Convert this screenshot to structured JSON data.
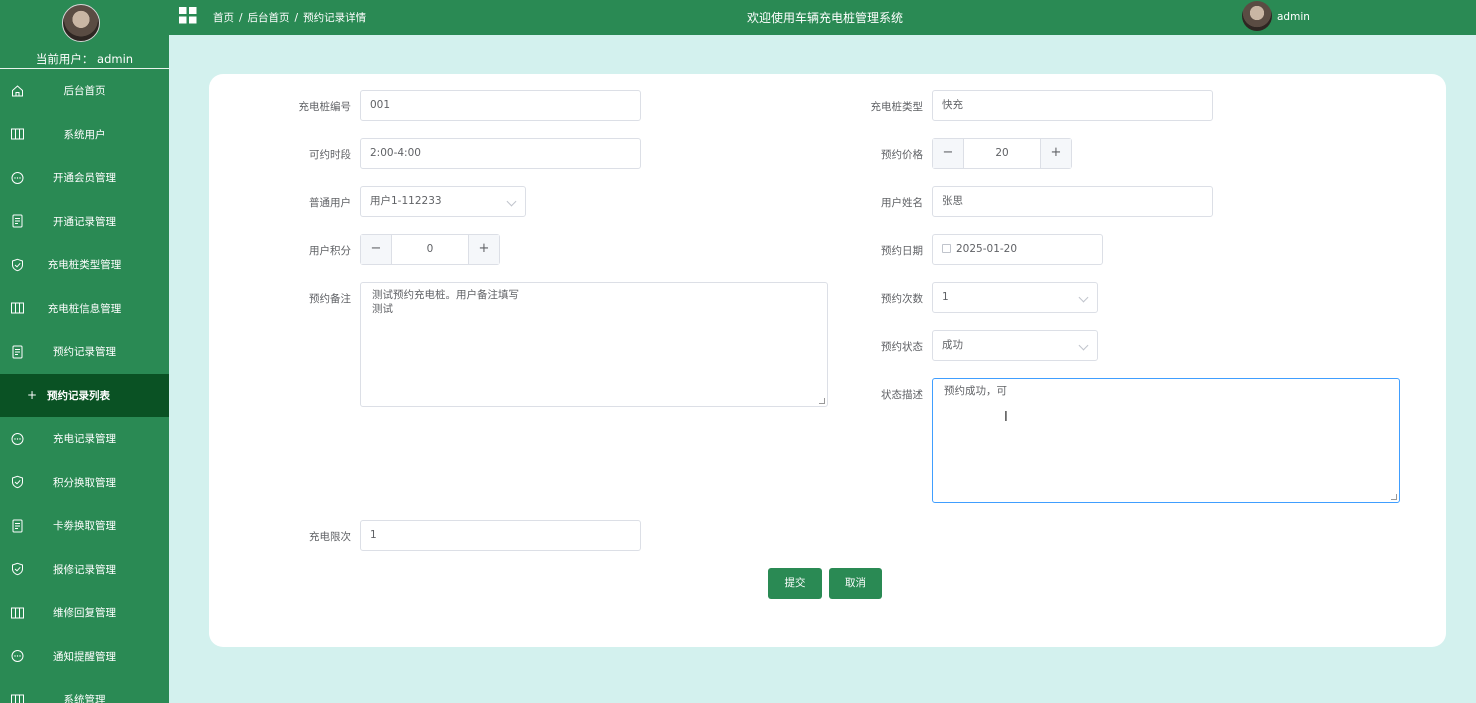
{
  "sidebar": {
    "current_user": "当前用户：  admin",
    "items": [
      {
        "label": "后台首页",
        "icon": "home-icon"
      },
      {
        "label": "系统用户",
        "icon": "columns-icon"
      },
      {
        "label": "开通会员管理",
        "icon": "chat-icon"
      },
      {
        "label": "开通记录管理",
        "icon": "document-icon"
      },
      {
        "label": "充电桩类型管理",
        "icon": "shield-icon"
      },
      {
        "label": "充电桩信息管理",
        "icon": "columns-icon"
      },
      {
        "label": "预约记录管理",
        "icon": "document-icon"
      },
      {
        "label": "预约记录列表",
        "icon": "plus-icon",
        "sub": true
      },
      {
        "label": "充电记录管理",
        "icon": "chat-icon"
      },
      {
        "label": "积分换取管理",
        "icon": "shield-icon"
      },
      {
        "label": "卡劵换取管理",
        "icon": "document-icon"
      },
      {
        "label": "报修记录管理",
        "icon": "shield-icon"
      },
      {
        "label": "维修回复管理",
        "icon": "columns-icon"
      },
      {
        "label": "通知提醒管理",
        "icon": "chat-icon"
      },
      {
        "label": "系统管理",
        "icon": "columns-icon"
      }
    ]
  },
  "header": {
    "breadcrumb": [
      "首页",
      "后台首页",
      "预约记录详情"
    ],
    "separator": "/",
    "title": "欢迎使用车辆充电桩管理系统",
    "username": "admin"
  },
  "form": {
    "pile_number": {
      "label": "充电桩编号",
      "value": "001"
    },
    "pile_type": {
      "label": "充电桩类型",
      "value": "快充"
    },
    "time_slot": {
      "label": "可约时段",
      "value": "2:00-4:00"
    },
    "price": {
      "label": "预约价格",
      "value": "20",
      "minus": "−",
      "plus": "+"
    },
    "normal_user": {
      "label": "普通用户",
      "value": "用户1-112233"
    },
    "user_name": {
      "label": "用户姓名",
      "value": "张思"
    },
    "points": {
      "label": "用户积分",
      "value": "0",
      "minus": "−",
      "plus": "+"
    },
    "date": {
      "label": "预约日期",
      "value": "2025-01-20"
    },
    "remark": {
      "label": "预约备注",
      "value": "测试预约充电桩。用户备注填写\n测试"
    },
    "count": {
      "label": "预约次数",
      "value": "1"
    },
    "status": {
      "label": "预约状态",
      "value": "成功"
    },
    "status_desc": {
      "label": "状态描述",
      "value": "预约成功，可"
    },
    "limit": {
      "label": "充电限次",
      "value": "1"
    },
    "submit_label": "提交",
    "cancel_label": "取消"
  },
  "colors": {
    "brand": "#2a8a54",
    "active_menu": "#0a5224",
    "background": "#d3f1ee",
    "focus": "#409eff"
  }
}
